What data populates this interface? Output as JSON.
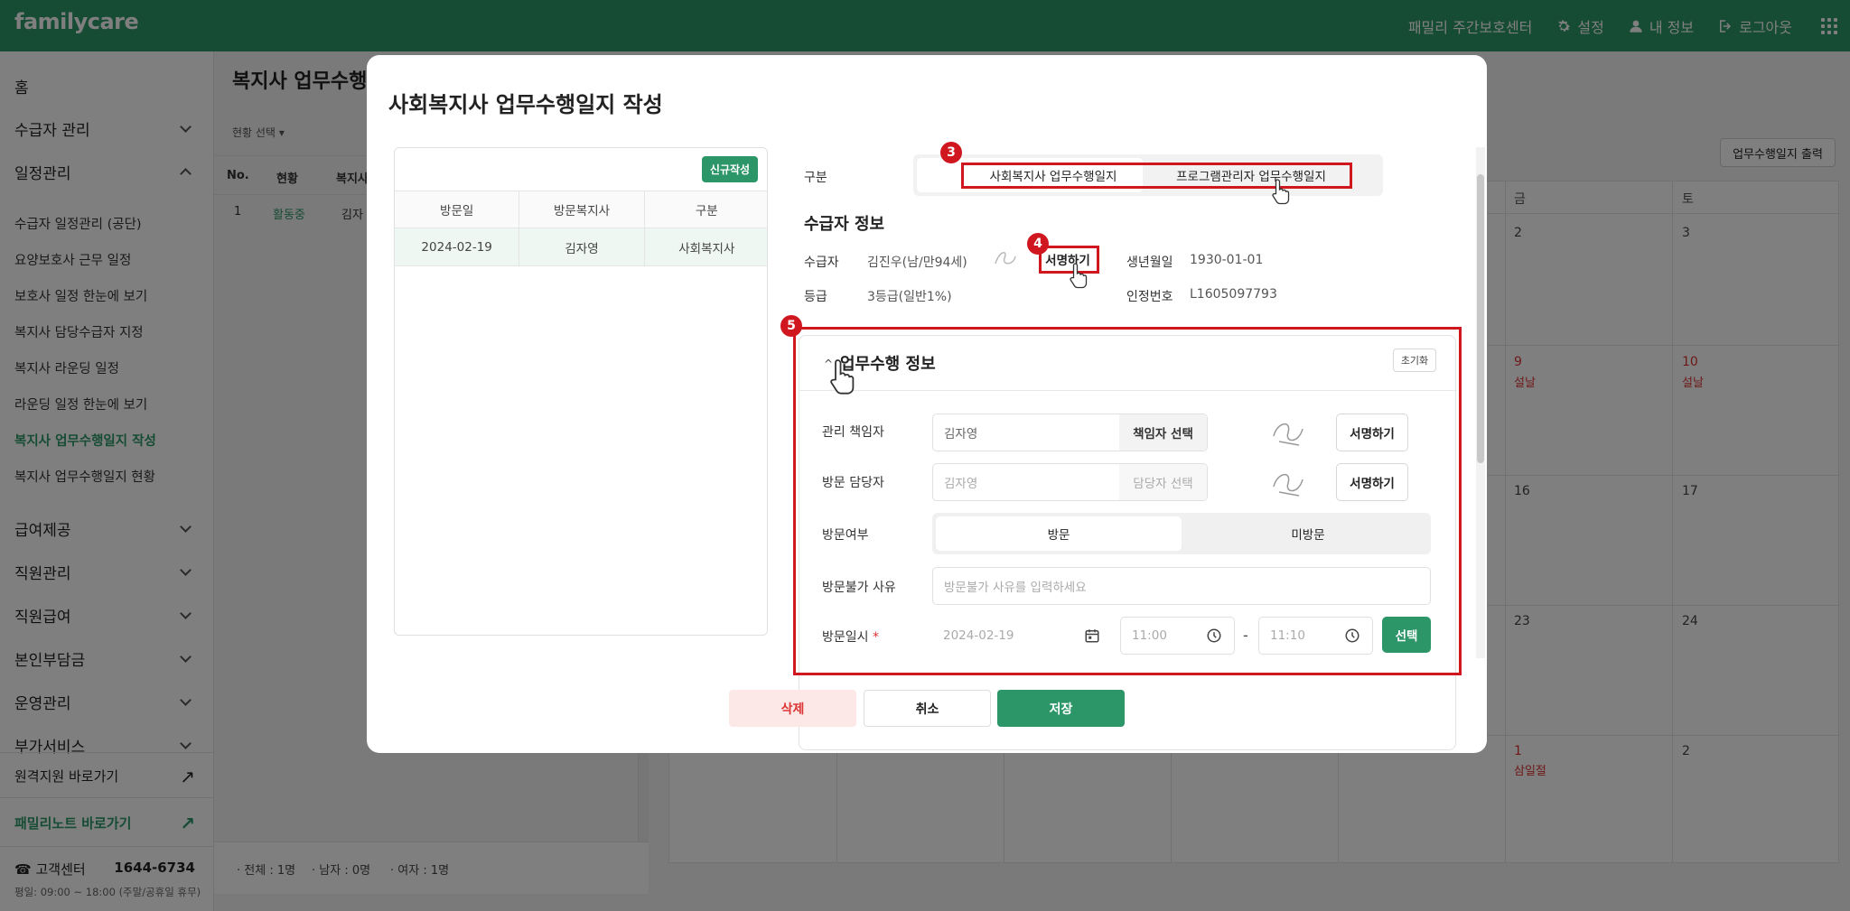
{
  "header": {
    "brand": "familycare",
    "center": "패밀리 주간보호센터",
    "settings": "설정",
    "my_info": "내 정보",
    "logout": "로그아웃"
  },
  "sidebar": {
    "home": "홈",
    "recipient_mgmt": "수급자 관리",
    "schedule_mgmt": "일정관리",
    "sub_items": [
      "수급자 일정관리 (공단)",
      "요양보호사 근무 일정",
      "보호사 일정 한눈에 보기",
      "복지사 담당수급자 지정",
      "복지사 라운딩 일정",
      "라운딩 일정 한눈에 보기",
      "복지사 업무수행일지 작성",
      "복지사 업무수행일지 현황"
    ],
    "more": [
      "급여제공",
      "직원관리",
      "직원급여",
      "본인부담금",
      "운영관리",
      "부가서비스"
    ],
    "remote_link": "원격지원 바로가기",
    "note_link": "패밀리노트 바로가기",
    "cs_label": "고객센터",
    "cs_phone": "1644-6734",
    "cs_hours": "평일: 09:00 ~ 18:00 (주말/공휴일 휴무)"
  },
  "background": {
    "title": "복지사 업무수행",
    "filter": "현황 선택",
    "cols": [
      "No.",
      "현황",
      "복지사"
    ],
    "row": [
      "1",
      "활동중",
      "김자"
    ],
    "stats": [
      "· 전체 : 1명",
      "· 남자 : 0명",
      "· 여자 : 1명"
    ],
    "print_btn": "업무수행일지 출력",
    "cal_head": [
      "금",
      "토"
    ],
    "cal_days": [
      "2",
      "3",
      "9",
      "10",
      "16",
      "17",
      "23",
      "24",
      "1",
      "2"
    ],
    "cal_events": [
      "설날",
      "설날",
      "삼일절"
    ]
  },
  "modal": {
    "title": "사회복지사 업무수행일지 작성",
    "new_btn": "신규작성",
    "list_cols": [
      "방문일",
      "방문복지사",
      "구분"
    ],
    "list_row": [
      "2024-02-19",
      "김자영",
      "사회복지사"
    ],
    "type_label": "구분",
    "type_options": [
      "사회복지사 업무수행일지",
      "프로그램관리자 업무수행일지"
    ],
    "recipient_section": "수급자 정보",
    "recipient_label": "수급자",
    "recipient_value": "김진우(남/만94세)",
    "sign_btn": "서명하기",
    "birth_label": "생년월일",
    "birth_value": "1930-01-01",
    "grade_label": "등급",
    "grade_value": "3등급(일반1%)",
    "cert_label": "인정번호",
    "cert_value": "L1605097793",
    "work_section": "업무수행 정보",
    "reset_btn": "초기화",
    "manager_label": "관리 책임자",
    "manager_value": "김자영",
    "manager_select": "책임자 선택",
    "visitor_label": "방문 담당자",
    "visitor_placeholder": "김자영",
    "visitor_select": "담당자 선택",
    "visit_label": "방문여부",
    "visit_options": [
      "방문",
      "미방문"
    ],
    "reason_label": "방문불가 사유",
    "reason_placeholder": "방문불가 사유를 입력하세요",
    "datetime_label": "방문일시",
    "required_mark": "*",
    "date_value": "2024-02-19",
    "time_from": "11:00",
    "time_dash": "-",
    "time_to": "11:10",
    "select_btn": "선택",
    "delete_btn": "삭제",
    "cancel_btn": "취소",
    "save_btn": "저장",
    "badges": [
      "3",
      "4",
      "5"
    ]
  },
  "colors": {
    "brand": "#2d9668",
    "annotation": "#d0161e",
    "danger_bg": "#fde8e8"
  }
}
